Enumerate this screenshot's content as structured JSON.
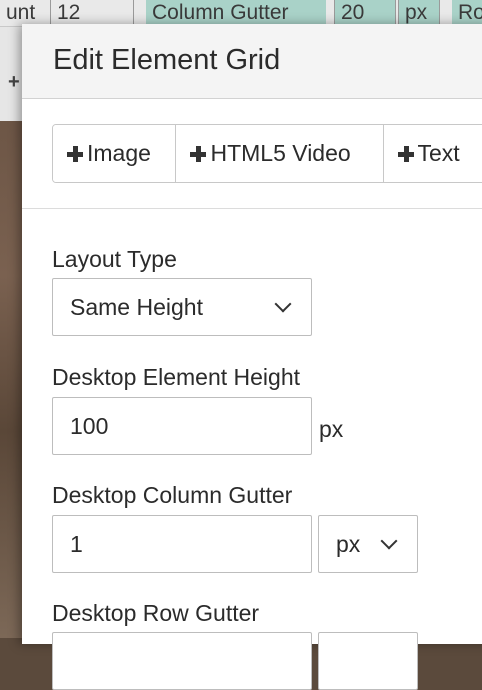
{
  "background": {
    "toolbar": {
      "cells": [
        "unt",
        "12",
        "Column Gutter",
        "20",
        "px",
        "Ro"
      ]
    },
    "plus_glyph": "+"
  },
  "modal": {
    "title": "Edit Element Grid",
    "add_buttons": [
      {
        "label": "Image",
        "icon": "plus-icon"
      },
      {
        "label": "HTML5 Video",
        "icon": "plus-icon"
      },
      {
        "label": "Text",
        "icon": "plus-icon"
      }
    ],
    "layout_type": {
      "label": "Layout Type",
      "value": "Same Height"
    },
    "element_height": {
      "label": "Desktop Element Height",
      "value": "100",
      "unit": "px"
    },
    "column_gutter": {
      "label": "Desktop Column Gutter",
      "value": "1",
      "unit": "px"
    },
    "row_gutter": {
      "label": "Desktop Row Gutter"
    }
  },
  "colors": {
    "teal_highlight": "#a9d2c8",
    "header_bg": "#f4f4f4",
    "border": "#c8c8c8",
    "text": "#2b2b2b"
  }
}
